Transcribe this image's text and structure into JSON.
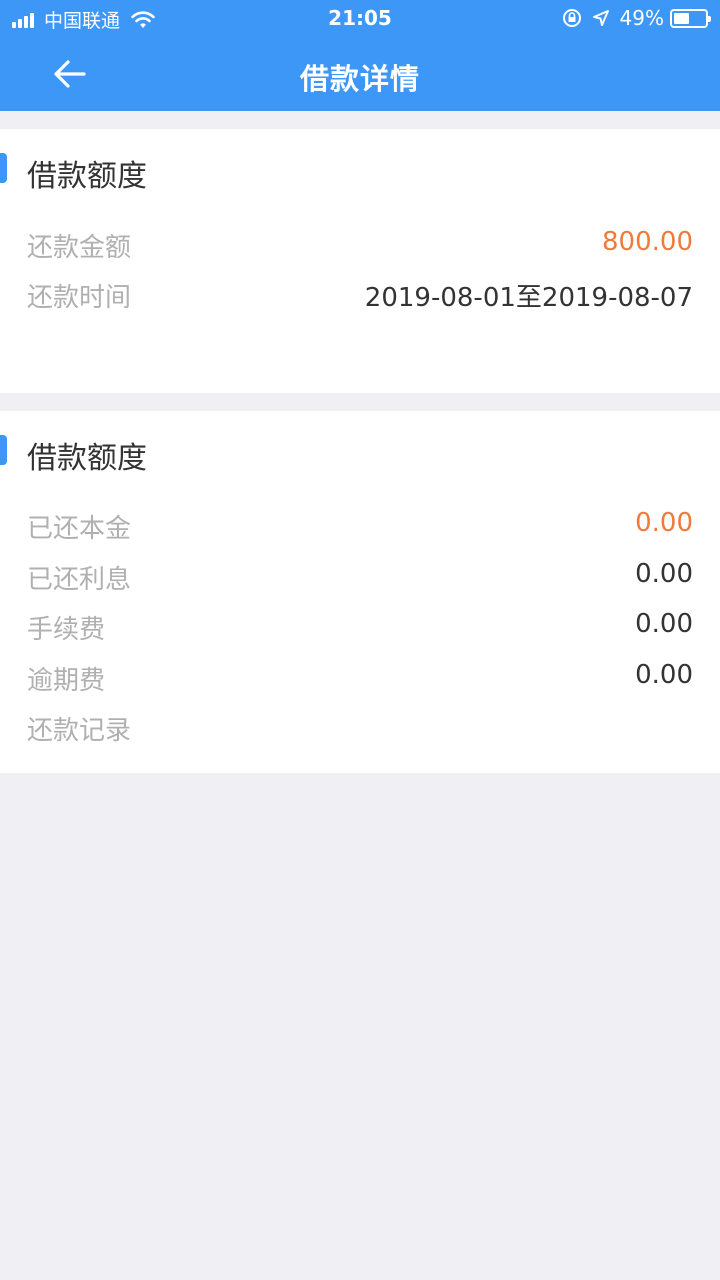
{
  "status_bar": {
    "carrier": "中国联通",
    "time": "21:05",
    "battery_percent": "49%",
    "battery_level": 0.49,
    "icons": [
      "signal-icon",
      "wifi-icon",
      "orientation-lock-icon",
      "location-arrow-icon",
      "battery-icon"
    ]
  },
  "nav": {
    "title": "借款详情",
    "back_icon": "arrow-left-icon"
  },
  "colors": {
    "primary": "#3d97f7",
    "accent_orange": "#f07a3a",
    "background": "#efeff4"
  },
  "loan_amount_card": {
    "title": "借款额度",
    "rows": [
      {
        "label": "还款金额",
        "value": "800.00"
      },
      {
        "label": "还款时间",
        "value": "2019-08-01至2019-08-07"
      }
    ]
  },
  "repayment_card": {
    "title": "借款额度",
    "rows": [
      {
        "label": "已还本金",
        "value": "0.00"
      },
      {
        "label": "已还利息",
        "value": "0.00"
      },
      {
        "label": "手续费",
        "value": "0.00"
      },
      {
        "label": "逾期费",
        "value": "0.00"
      },
      {
        "label": "还款记录",
        "value": ""
      }
    ]
  }
}
